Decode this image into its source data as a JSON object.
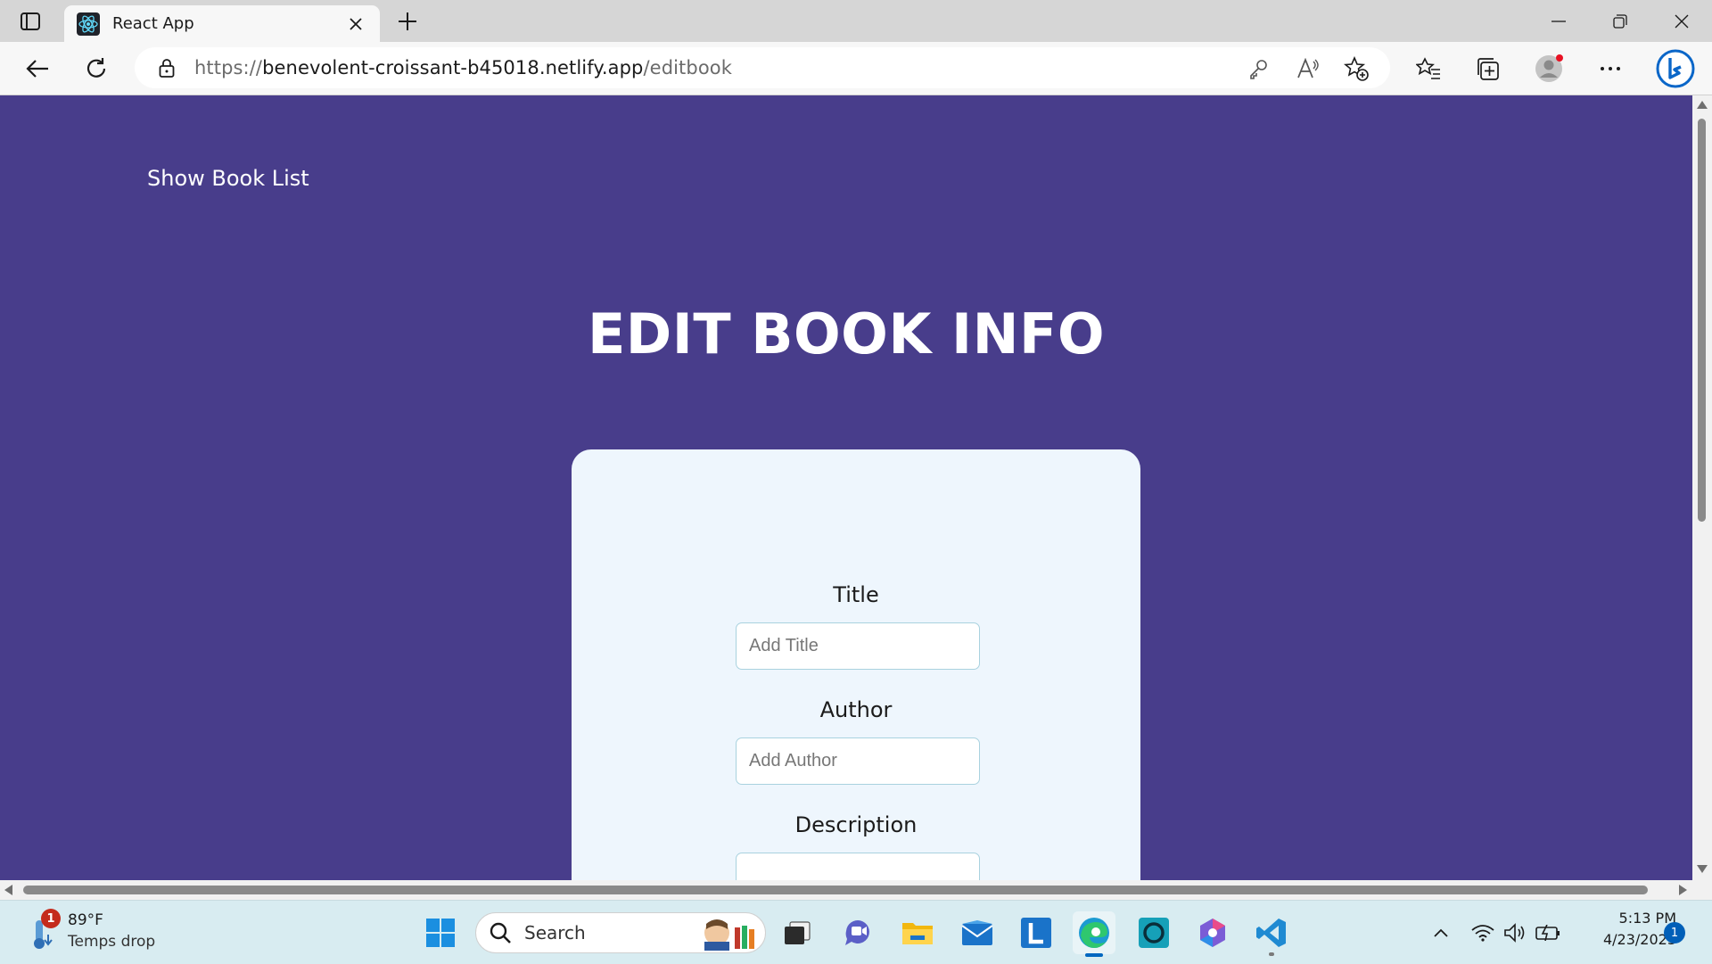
{
  "browser": {
    "tab_title": "React App",
    "url_scheme": "https://",
    "url_host": "benevolent-croissant-b45018.netlify.app",
    "url_path": "/editbook"
  },
  "page": {
    "nav_link": "Show Book List",
    "title": "EDIT BOOK INFO",
    "form": {
      "title_label": "Title",
      "title_placeholder": "Add Title",
      "author_label": "Author",
      "author_placeholder": "Add Author",
      "description_label": "Description"
    },
    "colors": {
      "background": "#483d8b",
      "card": "#eef6fd",
      "input_border": "#a9d2df"
    }
  },
  "taskbar": {
    "weather_badge": "1",
    "weather_temp": "89°F",
    "weather_condition": "Temps drop",
    "search_label": "Search",
    "apps": [
      "start-icon",
      "task-view-icon",
      "teams-icon",
      "file-explorer-icon",
      "mail-icon",
      "l-app-icon",
      "edge-icon",
      "alexa-icon",
      "copilot-icon",
      "vscode-icon"
    ],
    "time": "5:13 PM",
    "date": "4/23/2023",
    "notification_count": "1"
  }
}
